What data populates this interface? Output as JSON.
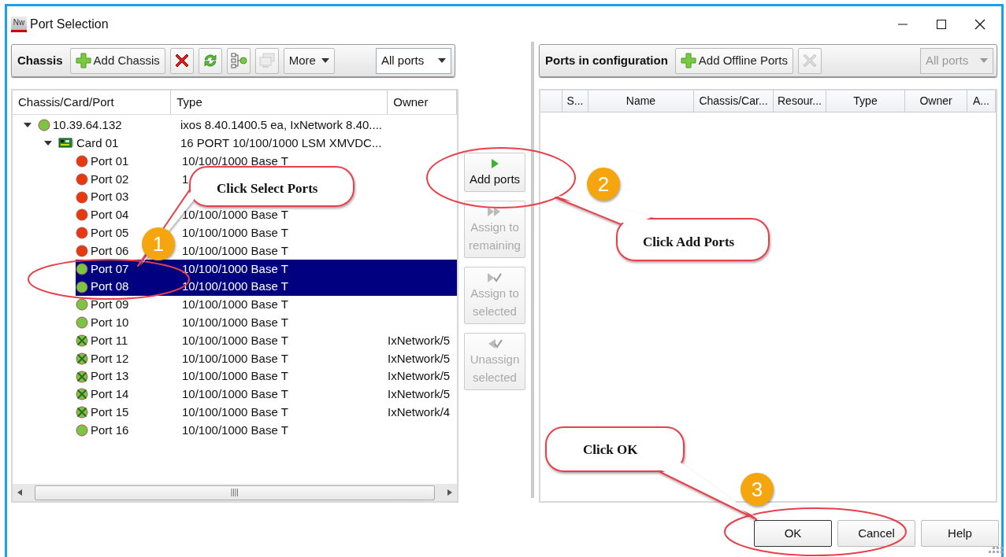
{
  "window": {
    "app_icon": "Nw",
    "title": "Port Selection"
  },
  "chassis_toolbar": {
    "label": "Chassis",
    "buttons": [
      {
        "kind": "add",
        "label": "Add Chassis",
        "disabled": false
      },
      {
        "kind": "delete",
        "disabled": false
      },
      {
        "kind": "refresh",
        "disabled": false
      },
      {
        "kind": "tree",
        "disabled": false
      },
      {
        "kind": "computers",
        "disabled": true
      },
      {
        "kind": "menu",
        "label": "More",
        "disabled": false
      }
    ],
    "filter": {
      "value": "All ports",
      "disabled": false
    }
  },
  "chassis_tree": {
    "columns": [
      "Chassis/Card/Port",
      "Type",
      "Owner"
    ],
    "items": [
      {
        "kind": "chassis",
        "name": "10.39.64.132",
        "type": "ixos 8.40.1400.5 ea, IxNetwork 8.40....",
        "color": "#7cc444",
        "expanded": true,
        "children": [
          {
            "kind": "card",
            "name": "Card 01",
            "type": "16 PORT 10/100/1000 LSM XMVDC...",
            "expanded": true,
            "children": [
              {
                "kind": "port",
                "name": "Port 01",
                "type": "10/100/1000 Base T",
                "color": "#e8380d",
                "owned": false,
                "selected": false
              },
              {
                "kind": "port",
                "name": "Port 02",
                "type": "1",
                "color": "#e8380d",
                "owned": false,
                "selected": false
              },
              {
                "kind": "port",
                "name": "Port 03",
                "color": "#e8380d",
                "owned": false,
                "selected": false
              },
              {
                "kind": "port",
                "name": "Port 04",
                "type": "10/100/1000 Base T",
                "color": "#e8380d",
                "owned": false,
                "selected": false
              },
              {
                "kind": "port",
                "name": "Port 05",
                "type": "10/100/1000 Base T",
                "color": "#e8380d",
                "owned": false,
                "selected": false
              },
              {
                "kind": "port",
                "name": "Port 06",
                "type": "10/100/1000 Base T",
                "color": "#e8380d",
                "owned": false,
                "selected": false
              },
              {
                "kind": "port",
                "name": "Port 07",
                "type": "10/100/1000 Base T",
                "color": "#7cc444",
                "owned": false,
                "selected": true
              },
              {
                "kind": "port",
                "name": "Port 08",
                "type": "10/100/1000 Base T",
                "color": "#7cc444",
                "owned": false,
                "selected": true
              },
              {
                "kind": "port",
                "name": "Port 09",
                "type": "10/100/1000 Base T",
                "color": "#7cc444",
                "owned": false,
                "selected": false
              },
              {
                "kind": "port",
                "name": "Port 10",
                "type": "10/100/1000 Base T",
                "color": "#7cc444",
                "owned": false,
                "selected": false
              },
              {
                "kind": "port",
                "name": "Port 11",
                "type": "10/100/1000 Base T",
                "owner": "IxNetwork/5",
                "color": "#7cc444",
                "owned": true,
                "selected": false
              },
              {
                "kind": "port",
                "name": "Port 12",
                "type": "10/100/1000 Base T",
                "owner": "IxNetwork/5",
                "color": "#7cc444",
                "owned": true,
                "selected": false
              },
              {
                "kind": "port",
                "name": "Port 13",
                "type": "10/100/1000 Base T",
                "owner": "IxNetwork/5",
                "color": "#7cc444",
                "owned": true,
                "selected": false
              },
              {
                "kind": "port",
                "name": "Port 14",
                "type": "10/100/1000 Base T",
                "owner": "IxNetwork/5",
                "color": "#7cc444",
                "owned": true,
                "selected": false
              },
              {
                "kind": "port",
                "name": "Port 15",
                "type": "10/100/1000 Base T",
                "owner": "IxNetwork/4",
                "color": "#7cc444",
                "owned": true,
                "selected": false
              },
              {
                "kind": "port",
                "name": "Port 16",
                "type": "10/100/1000 Base T",
                "color": "#7cc444",
                "owned": false,
                "selected": false
              }
            ]
          }
        ]
      }
    ]
  },
  "transfer_buttons": [
    {
      "kind": "add",
      "label": "Add ports",
      "disabled": false
    },
    {
      "kind": "assign_remaining",
      "label": "Assign to remaining",
      "disabled": true
    },
    {
      "kind": "assign_selected",
      "label": "Assign to selected",
      "disabled": true
    },
    {
      "kind": "unassign",
      "label": "Unassign selected",
      "disabled": true
    }
  ],
  "config_toolbar": {
    "label": "Ports in configuration",
    "buttons": [
      {
        "kind": "add",
        "label": "Add Offline Ports",
        "disabled": false
      },
      {
        "kind": "delete",
        "disabled": true
      }
    ],
    "filter": {
      "value": "All ports",
      "disabled": true
    }
  },
  "config_table": {
    "columns": [
      "S...",
      "Name",
      "Chassis/Car...",
      "Resour...",
      "Type",
      "Owner",
      "A..."
    ]
  },
  "dialog_buttons": [
    {
      "label": "OK",
      "default": true
    },
    {
      "label": "Cancel",
      "default": false
    },
    {
      "label": "Help",
      "default": false
    }
  ],
  "annotations": [
    {
      "step": "1",
      "callout": "Click Select Ports"
    },
    {
      "step": "2",
      "callout": "Click Add Ports"
    },
    {
      "step": "3",
      "callout": "Click OK"
    }
  ]
}
